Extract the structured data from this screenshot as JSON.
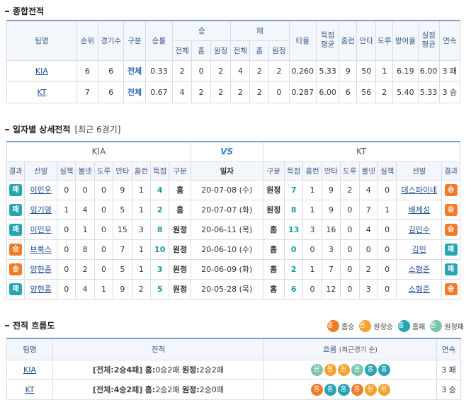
{
  "summary": {
    "title": "종합전적",
    "headers": {
      "team": "팀명",
      "rank": "순위",
      "games": "경기수",
      "type": "구분",
      "pct": "승률",
      "win": "승",
      "loss": "패",
      "total": "전체",
      "home": "홈",
      "away": "원정",
      "avg": "타율",
      "runs": "득점 평균",
      "hr": "홈런",
      "hits": "안타",
      "sb": "도루",
      "era": "방어율",
      "ra": "실점 평균",
      "streak": "연속"
    },
    "rows": [
      {
        "team": "KIA",
        "rank": "6",
        "games": "6",
        "type": "전체",
        "pct": "0.33",
        "w_total": "2",
        "w_home": "0",
        "w_away": "2",
        "l_total": "4",
        "l_home": "2",
        "l_away": "2",
        "avg": "0.260",
        "runs": "5.33",
        "hr": "9",
        "hits": "50",
        "sb": "1",
        "era": "6.19",
        "ra": "6.00",
        "streak": "3 패"
      },
      {
        "team": "KT",
        "rank": "7",
        "games": "6",
        "type": "전체",
        "pct": "0.67",
        "w_total": "4",
        "w_home": "2",
        "w_away": "2",
        "l_total": "2",
        "l_home": "2",
        "l_away": "0",
        "avg": "0.287",
        "runs": "6.00",
        "hr": "6",
        "hits": "56",
        "sb": "2",
        "era": "5.40",
        "ra": "5.33",
        "streak": "3 승"
      }
    ]
  },
  "detail": {
    "title": "일자별 상세전적",
    "subtitle": "[최근 6경기]",
    "team_left": "KIA",
    "team_right": "KT",
    "vs": "VS",
    "headers": {
      "result": "결과",
      "pitcher": "선발",
      "err": "실책",
      "bb": "볼넷",
      "sb": "도루",
      "hits": "안타",
      "hr": "홈런",
      "runs": "득점",
      "type": "구분",
      "date": "일자"
    },
    "rows": [
      {
        "l_res": "패",
        "l_p": "이민우",
        "l_err": "0",
        "l_bb": "0",
        "l_sb": "0",
        "l_h": "9",
        "l_hr": "1",
        "l_r": "4",
        "l_type": "홈",
        "date": "20-07-08 (수)",
        "r_type": "원정",
        "r_r": "7",
        "r_hr": "1",
        "r_h": "9",
        "r_sb": "2",
        "r_bb": "4",
        "r_err": "0",
        "r_p": "데스파이네",
        "r_res": "승"
      },
      {
        "l_res": "패",
        "l_p": "임기영",
        "l_err": "1",
        "l_bb": "4",
        "l_sb": "0",
        "l_h": "5",
        "l_hr": "1",
        "l_r": "2",
        "l_type": "홈",
        "date": "20-07-07 (화)",
        "r_type": "원정",
        "r_r": "8",
        "r_hr": "1",
        "r_h": "9",
        "r_sb": "0",
        "r_bb": "7",
        "r_err": "1",
        "r_p": "배제성",
        "r_res": "승"
      },
      {
        "l_res": "패",
        "l_p": "이민우",
        "l_err": "0",
        "l_bb": "1",
        "l_sb": "0",
        "l_h": "15",
        "l_hr": "3",
        "l_r": "8",
        "l_type": "원정",
        "date": "20-06-11 (목)",
        "r_type": "홈",
        "r_r": "13",
        "r_hr": "3",
        "r_h": "16",
        "r_sb": "0",
        "r_bb": "4",
        "r_err": "0",
        "r_p": "김민수",
        "r_res": "승"
      },
      {
        "l_res": "승",
        "l_p": "브룩스",
        "l_err": "0",
        "l_bb": "8",
        "l_sb": "0",
        "l_h": "7",
        "l_hr": "1",
        "l_r": "10",
        "l_type": "원정",
        "date": "20-06-10 (수)",
        "r_type": "홈",
        "r_r": "0",
        "r_hr": "0",
        "r_h": "3",
        "r_sb": "0",
        "r_bb": "0",
        "r_err": "0",
        "r_p": "김민",
        "r_res": "패"
      },
      {
        "l_res": "승",
        "l_p": "양현종",
        "l_err": "0",
        "l_bb": "2",
        "l_sb": "0",
        "l_h": "5",
        "l_hr": "1",
        "l_r": "3",
        "l_type": "원정",
        "date": "20-06-09 (화)",
        "r_type": "홈",
        "r_r": "2",
        "r_hr": "1",
        "r_h": "7",
        "r_sb": "0",
        "r_bb": "2",
        "r_err": "0",
        "r_p": "소형준",
        "r_res": "패"
      },
      {
        "l_res": "패",
        "l_p": "양현종",
        "l_err": "0",
        "l_bb": "4",
        "l_sb": "1",
        "l_h": "9",
        "l_hr": "2",
        "l_r": "5",
        "l_type": "원정",
        "date": "20-05-28 (목)",
        "r_type": "홈",
        "r_r": "6",
        "r_hr": "0",
        "r_h": "12",
        "r_sb": "0",
        "r_bb": "3",
        "r_err": "0",
        "r_p": "소형준",
        "r_res": "승"
      }
    ]
  },
  "flow": {
    "title": "전적 흐름도",
    "legend": [
      {
        "glyph": "홈",
        "label": "홈승",
        "kind": "hw"
      },
      {
        "glyph": "원",
        "label": "원정승",
        "kind": "aw"
      },
      {
        "glyph": "홈",
        "label": "홈패",
        "kind": "hl"
      },
      {
        "glyph": "원",
        "label": "원정패",
        "kind": "al"
      }
    ],
    "headers": {
      "team": "팀명",
      "record": "전적",
      "flow": "흐름",
      "flow_sub": "(최근경기 순)",
      "streak": "연속"
    },
    "rows": [
      {
        "team": "KIA",
        "total": "[전체:2승4패]",
        "home_label": "홈:",
        "home": "0승2패",
        "away_label": "원정:",
        "away": "2승2패",
        "flow": [
          {
            "g": "원",
            "k": "al"
          },
          {
            "g": "원",
            "k": "aw"
          },
          {
            "g": "원",
            "k": "aw"
          },
          {
            "g": "원",
            "k": "al"
          },
          {
            "g": "홈",
            "k": "hl"
          },
          {
            "g": "홈",
            "k": "hl"
          }
        ],
        "streak": "3 패"
      },
      {
        "team": "KT",
        "total": "[전체:4승2패]",
        "home_label": "홈:",
        "home": "2승2패",
        "away_label": "원정:",
        "away": "2승0패",
        "flow": [
          {
            "g": "홈",
            "k": "hw"
          },
          {
            "g": "홈",
            "k": "hl"
          },
          {
            "g": "홈",
            "k": "hl"
          },
          {
            "g": "홈",
            "k": "hw"
          },
          {
            "g": "원",
            "k": "aw"
          },
          {
            "g": "원",
            "k": "aw"
          }
        ],
        "streak": "3 승"
      }
    ]
  }
}
